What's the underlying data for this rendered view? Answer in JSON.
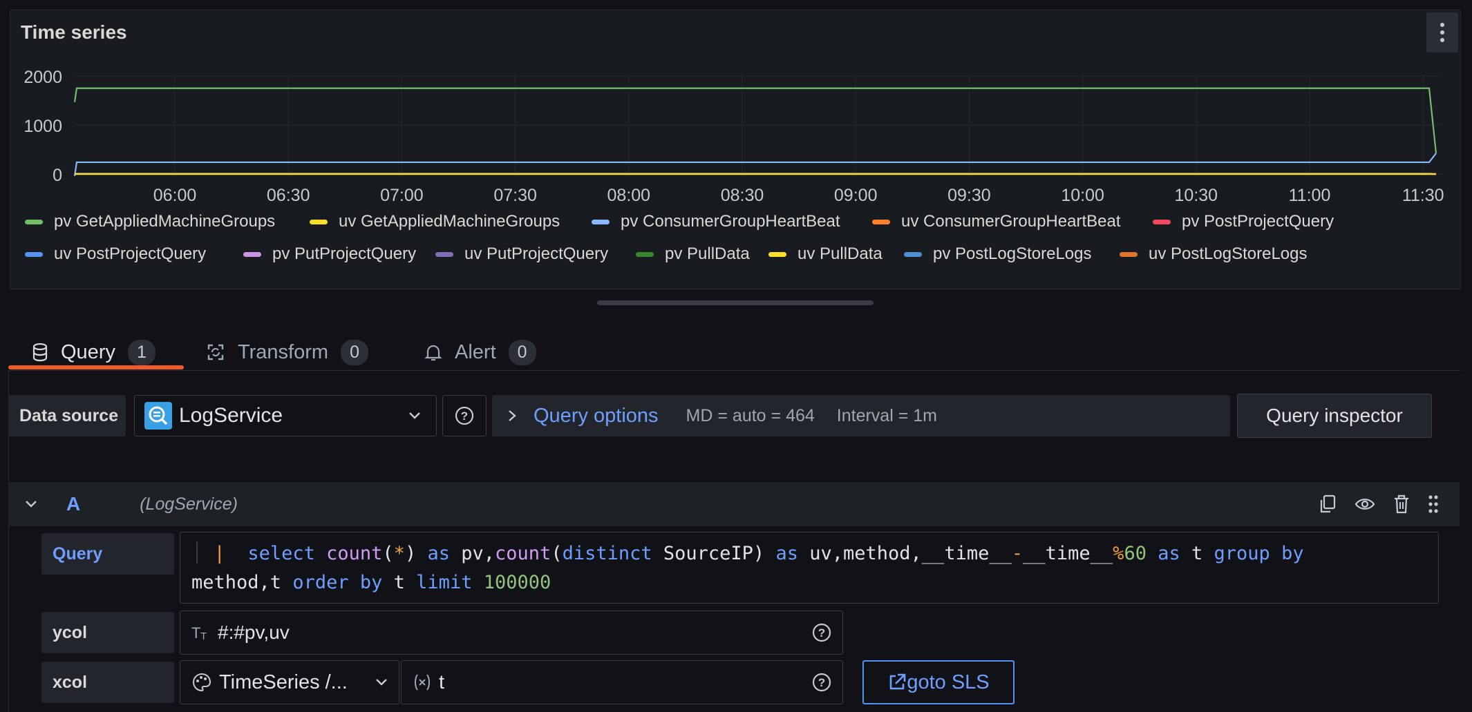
{
  "panel": {
    "title": "Time series",
    "menu_icon": "kebab-vertical-icon"
  },
  "chart_data": {
    "type": "line",
    "x_ticks": [
      "06:00",
      "06:30",
      "07:00",
      "07:30",
      "08:00",
      "08:30",
      "09:00",
      "09:30",
      "10:00",
      "10:30",
      "11:00",
      "11:30"
    ],
    "y_ticks": [
      2000,
      1000,
      0
    ],
    "ylim": [
      0,
      2000
    ],
    "grid": true,
    "legend_position": "bottom",
    "series": [
      {
        "name": "pv GetAppliedMachineGroups",
        "color": "#73bf69",
        "level": 1750
      },
      {
        "name": "uv GetAppliedMachineGroups",
        "color": "#fade2a",
        "level": 2
      },
      {
        "name": "pv ConsumerGroupHeartBeat",
        "color": "#8ab8ff",
        "level": 240
      },
      {
        "name": "uv ConsumerGroupHeartBeat",
        "color": "#ff7f2a",
        "level": 2
      },
      {
        "name": "pv PostProjectQuery",
        "color": "#f2495c",
        "level": 0
      },
      {
        "name": "uv PostProjectQuery",
        "color": "#5794f2",
        "level": 10
      },
      {
        "name": "pv PutProjectQuery",
        "color": "#ca95e5",
        "level": 0
      },
      {
        "name": "uv PutProjectQuery",
        "color": "#7e70b5",
        "level": 0
      },
      {
        "name": "pv PullData",
        "color": "#37872d",
        "level": 0
      },
      {
        "name": "uv PullData",
        "color": "#fade2a",
        "level": 0
      },
      {
        "name": "pv PostLogStoreLogs",
        "color": "#4e8fd2",
        "level": 5
      },
      {
        "name": "uv PostLogStoreLogs",
        "color": "#e0752d",
        "level": 0
      }
    ]
  },
  "tabs": [
    {
      "label": "Query",
      "count": "1",
      "icon": "database-icon",
      "active": true
    },
    {
      "label": "Transform",
      "count": "0",
      "icon": "transform-icon",
      "active": false
    },
    {
      "label": "Alert",
      "count": "0",
      "icon": "bell-icon",
      "active": false
    }
  ],
  "datasource": {
    "label": "Data source",
    "value": "LogService",
    "help_icon": "question-circle-icon",
    "query_options_label": "Query options",
    "md": "MD = auto = 464",
    "interval": "Interval = 1m",
    "inspector_label": "Query inspector"
  },
  "query_row": {
    "ref_id": "A",
    "datasource_hint": "(LogService)",
    "query_label": "Query",
    "ycol_label": "ycol",
    "ycol_value": "#:#pv,uv",
    "xcol_label": "xcol",
    "xcol_mode": "TimeSeries /...",
    "xcol_value": "t",
    "goto_label": "goto SLS",
    "code": {
      "pipe": "|",
      "select": "select",
      "count1": "count",
      "p1": "(",
      "star": "*",
      "p2": ")",
      "as1": "as",
      "pv": "pv,",
      "count2": "count",
      "p3": "(",
      "distinct": "distinct",
      "sourceip": "SourceIP)",
      "as2": "as",
      "uvm": "uv,method,__time__",
      "minus": "-",
      "time2": "__time__",
      "pct": "%",
      "sixty": "60",
      "as3": "as",
      "t1": "t",
      "group": "group",
      "by1": "by",
      "line2a": "method,t",
      "order": "order",
      "by2": "by",
      "t2": "t",
      "limit": "limit",
      "limitval": "100000"
    }
  }
}
